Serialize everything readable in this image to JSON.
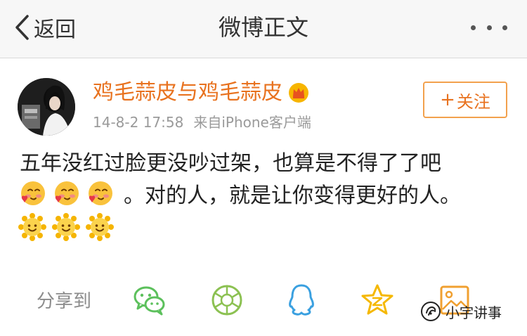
{
  "nav": {
    "back_label": "返回",
    "title": "微博正文",
    "more_icon": "more-dots-icon"
  },
  "post": {
    "username": "鸡毛蒜皮与鸡毛蒜皮",
    "badge_icon": "vip-crown-icon",
    "timestamp": "14-8-2 17:58",
    "source": "来自iPhone客户端",
    "follow_label": "关注",
    "follow_plus": "+",
    "text_line1": "五年没红过脸更没吵过架，也算是不得了了吧",
    "text_line2": "。对的人，就是让你变得更好的人。",
    "emoji_row1": [
      "blush-heart-emoji-icon",
      "blush-heart-emoji-icon",
      "blush-heart-emoji-icon"
    ],
    "emoji_row2": [
      "sun-smile-emoji-icon",
      "sun-smile-emoji-icon",
      "sun-smile-emoji-icon"
    ]
  },
  "share": {
    "label": "分享到",
    "targets": [
      "wechat-icon",
      "moments-icon",
      "qq-icon",
      "qzone-icon",
      "image-icon"
    ]
  },
  "watermark": {
    "text": "小宇讲事"
  },
  "colors": {
    "accent": "#e8721f",
    "follow_border": "#f2a14d",
    "wechat": "#5cc05c",
    "moments": "#8cc152",
    "qq": "#3aa0e0",
    "qzone": "#f5b800",
    "nav_bg": "#f7f7f7"
  }
}
